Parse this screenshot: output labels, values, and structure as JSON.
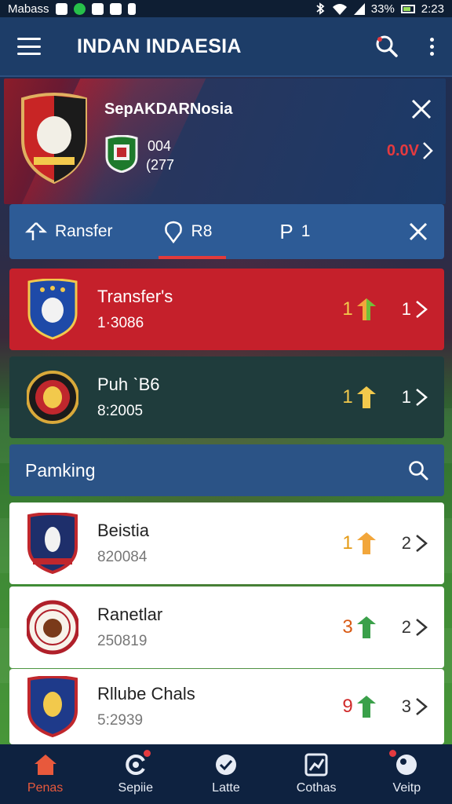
{
  "status_bar": {
    "carrier": "Mabass",
    "battery": "33%",
    "time": "2:23"
  },
  "app_bar": {
    "title": "INDAN INDAESIA"
  },
  "match_card": {
    "league": "SepAKDARNosia",
    "score_top": "004",
    "score_bottom": "(277",
    "odds": "0.0V"
  },
  "tabs": [
    {
      "label": "Ransfer",
      "icon": "arrow-icon"
    },
    {
      "label": "R8",
      "icon": "location-icon"
    },
    {
      "label": "1",
      "icon": "p-icon",
      "prefix": "P"
    }
  ],
  "featured_rows": [
    {
      "name": "Transfer's",
      "sub": "1·3086",
      "rank": "1",
      "pos": "1",
      "color": "#c5202b"
    },
    {
      "name": "Puh ˋB6",
      "sub": "8:2005",
      "rank": "1",
      "pos": "1",
      "color": "#1f3c3c"
    }
  ],
  "ranking": {
    "label": "Pamking"
  },
  "ranking_rows": [
    {
      "name": "Beistia",
      "sub": "820084",
      "rank": "1",
      "pos": "2"
    },
    {
      "name": "Ranetlar",
      "sub": "250819",
      "rank": "3",
      "pos": "2"
    },
    {
      "name": "Rllube Chals",
      "sub": "5:2939",
      "rank": "9",
      "pos": "3"
    }
  ],
  "bottom_nav": [
    {
      "label": "Penas",
      "icon": "home-icon",
      "active": true
    },
    {
      "label": "Sepiie",
      "icon": "refresh-icon",
      "active": false
    },
    {
      "label": "Latte",
      "icon": "check-icon",
      "active": false
    },
    {
      "label": "Cothas",
      "icon": "chart-icon",
      "active": false
    },
    {
      "label": "Veitp",
      "icon": "ball-icon",
      "active": false
    }
  ],
  "colors": {
    "app_bar": "#1d3d68",
    "accent_red": "#c5202b",
    "tab_bar": "#2d5b96",
    "bottom_nav": "#0e2240"
  }
}
